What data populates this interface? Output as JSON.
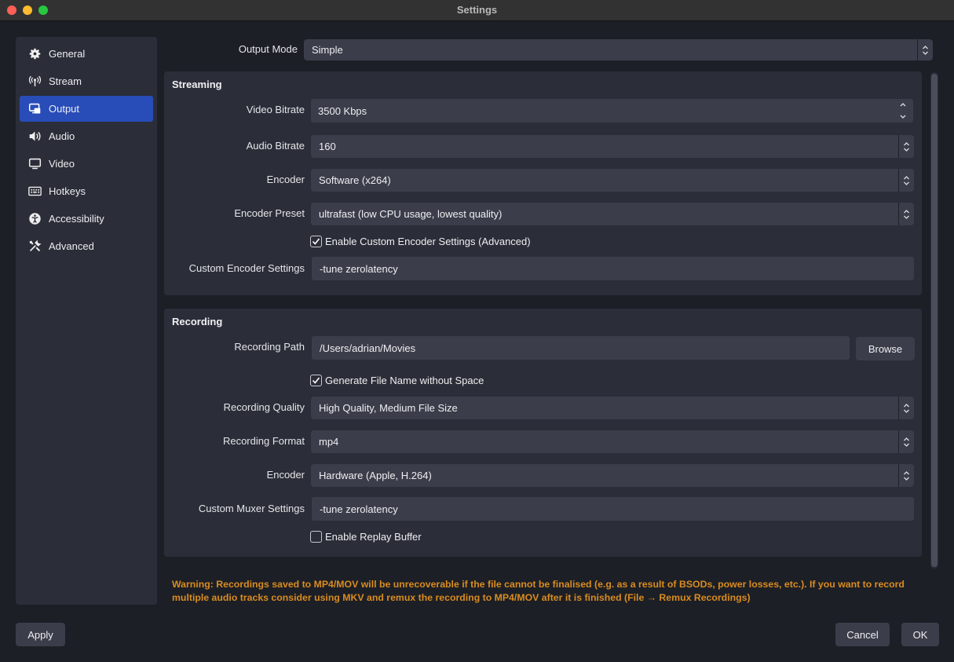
{
  "window": {
    "title": "Settings"
  },
  "sidebar": {
    "items": [
      {
        "label": "General",
        "icon": "gear-icon",
        "active": false
      },
      {
        "label": "Stream",
        "icon": "broadcast-icon",
        "active": false
      },
      {
        "label": "Output",
        "icon": "output-icon",
        "active": true
      },
      {
        "label": "Audio",
        "icon": "speaker-icon",
        "active": false
      },
      {
        "label": "Video",
        "icon": "monitor-icon",
        "active": false
      },
      {
        "label": "Hotkeys",
        "icon": "keyboard-icon",
        "active": false
      },
      {
        "label": "Accessibility",
        "icon": "accessibility-icon",
        "active": false
      },
      {
        "label": "Advanced",
        "icon": "tools-icon",
        "active": false
      }
    ]
  },
  "output_mode": {
    "label": "Output Mode",
    "value": "Simple"
  },
  "streaming": {
    "title": "Streaming",
    "video_bitrate": {
      "label": "Video Bitrate",
      "value": "3500 Kbps"
    },
    "audio_bitrate": {
      "label": "Audio Bitrate",
      "value": "160"
    },
    "encoder": {
      "label": "Encoder",
      "value": "Software (x264)"
    },
    "encoder_preset": {
      "label": "Encoder Preset",
      "value": "ultrafast (low CPU usage, lowest quality)"
    },
    "custom_encoder_checkbox": {
      "label": "Enable Custom Encoder Settings (Advanced)",
      "checked": true
    },
    "custom_encoder_settings": {
      "label": "Custom Encoder Settings",
      "value": "-tune zerolatency"
    }
  },
  "recording": {
    "title": "Recording",
    "path": {
      "label": "Recording Path",
      "value": "/Users/adrian/Movies"
    },
    "browse_label": "Browse",
    "no_space_checkbox": {
      "label": "Generate File Name without Space",
      "checked": true
    },
    "quality": {
      "label": "Recording Quality",
      "value": "High Quality, Medium File Size"
    },
    "format": {
      "label": "Recording Format",
      "value": "mp4"
    },
    "encoder": {
      "label": "Encoder",
      "value": "Hardware (Apple, H.264)"
    },
    "muxer": {
      "label": "Custom Muxer Settings",
      "value": "-tune zerolatency"
    },
    "replay_checkbox": {
      "label": "Enable Replay Buffer",
      "checked": false
    }
  },
  "warning": {
    "line1": "Warning: Recordings saved to MP4/MOV will be unrecoverable if the file cannot be finalised (e.g. as a result of BSODs, power losses, etc.). If you want to record",
    "line2": "multiple audio tracks consider using MKV and remux the recording to MP4/MOV after it is finished (File → Remux Recordings)"
  },
  "footer": {
    "apply_label": "Apply",
    "cancel_label": "Cancel",
    "ok_label": "OK"
  },
  "colors": {
    "accent": "#284cb8",
    "warning": "#d98c1f",
    "panel": "#2b2e38",
    "background": "#1d1f26"
  }
}
